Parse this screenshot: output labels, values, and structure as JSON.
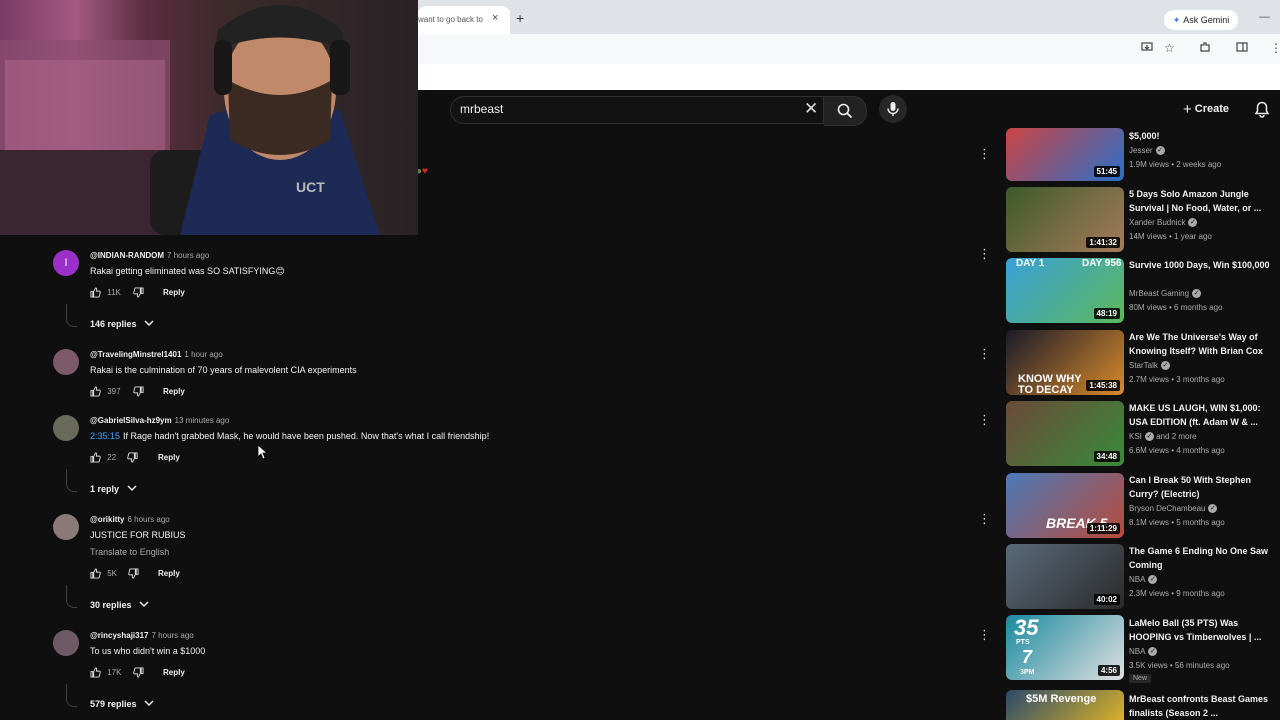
{
  "browser": {
    "tab_title": "want to go back to",
    "tab_close_icon": "×",
    "new_tab_icon": "+",
    "gemini_label": "Ask Gemini",
    "minimize_icon": "—"
  },
  "header": {
    "search_value": "mrbeast",
    "clear_icon": "✕",
    "create_label": "Create",
    "create_icon": "+"
  },
  "comments": [
    {
      "author": "@INDIAN-RANDOM",
      "time": "7 hours ago",
      "text": "Rakai getting eliminated was SO SATISFYING😊",
      "likes": "11K",
      "reply": "Reply",
      "replies": "146 replies",
      "avatar_letter": "I",
      "avatar_color": "#9b30c8"
    },
    {
      "author": "@TravelingMinstrel1401",
      "time": "1 hour ago",
      "text": "Rakai is the culmination of 70 years of malevolent CIA experiments",
      "likes": "397",
      "reply": "Reply",
      "avatar_color": "#7d5a6a"
    },
    {
      "author": "@GabrielSilva-hz9ym",
      "time": "13 minutes ago",
      "timestamp": "2:35:15",
      "text": "If Rage hadn't grabbed Mask, he would have been pushed. Now that's what I call friendship!",
      "likes": "22",
      "reply": "Reply",
      "replies": "1 reply",
      "avatar_color": "#6a6a5a"
    },
    {
      "author": "@orikitty",
      "time": "6 hours ago",
      "text": "JUSTICE FOR RUBIUS",
      "translate": "Translate to English",
      "likes": "5K",
      "reply": "Reply",
      "replies": "30 replies",
      "avatar_color": "#8a7a78"
    },
    {
      "author": "@rincyshaji317",
      "time": "7 hours ago",
      "text": "To us who didn't win a $1000",
      "likes": "17K",
      "reply": "Reply",
      "replies": "579 replies",
      "avatar_color": "#6e5a66"
    }
  ],
  "videos": [
    {
      "title": "$5,000!",
      "channel": "Jesser",
      "meta": "1.9M views • 2 weeks ago",
      "duration": "51:45",
      "colors": [
        "#c44",
        "#2a6fc8"
      ]
    },
    {
      "title": "5 Days Solo Amazon Jungle Survival | No Food, Water, or ...",
      "channel": "Xander Budnick",
      "meta": "14M views • 1 year ago",
      "duration": "1:41:32",
      "colors": [
        "#3d5a2a",
        "#a67b5b"
      ]
    },
    {
      "title": "Survive 1000 Days, Win $100,000",
      "channel": "MrBeast Gaming",
      "meta": "80M views • 6 months ago",
      "duration": "48:19",
      "colors": [
        "#3aa0d8",
        "#5cb85c"
      ],
      "overlay_left": "DAY 1",
      "overlay_right": "DAY 956"
    },
    {
      "title": "Are We The Universe's Way of Knowing Itself? With Brian Cox",
      "channel": "StarTalk",
      "meta": "2.7M views • 3 months ago",
      "duration": "1:45:38",
      "colors": [
        "#1a1a2a",
        "#d88a2a"
      ],
      "overlay_text": "KNOW WHY TO DECAY"
    },
    {
      "title": "MAKE US LAUGH, WIN $1,000: USA EDITION (ft. Adam W & ...",
      "channel": "KSI",
      "channel_extra": "and 2 more",
      "meta": "6.6M views • 4 months ago",
      "duration": "34:48",
      "colors": [
        "#6b4a3a",
        "#3a8a3a"
      ]
    },
    {
      "title": "Can I Break 50 With Stephen Curry? (Electric)",
      "channel": "Bryson DeChambeau",
      "meta": "8.1M views • 5 months ago",
      "duration": "1:11:29",
      "colors": [
        "#4a7ab8",
        "#b84a3a"
      ],
      "overlay_text": "BREAK 5"
    },
    {
      "title": "The Game 6 Ending No One Saw Coming",
      "channel": "NBA",
      "meta": "2.3M views • 9 months ago",
      "duration": "40:02",
      "colors": [
        "#5a6a7a",
        "#2a2a2a"
      ]
    },
    {
      "title": "LaMelo Ball (35 PTS) Was HOOPING vs Timberwolves | ...",
      "channel": "NBA",
      "meta": "3.5K views • 56 minutes ago",
      "duration": "4:56",
      "badge": "New",
      "colors": [
        "#1a8aa0",
        "#e0e0e0"
      ],
      "overlay_big": "35",
      "overlay_small": "PTS",
      "overlay_big2": "7",
      "overlay_small2": "3PM"
    },
    {
      "title": "MrBeast confronts Beast Games finalists (Season 2 ...",
      "channel": "",
      "meta": "",
      "duration": "",
      "colors": [
        "#2a4a6a",
        "#d8b02a"
      ],
      "overlay_text": "$5M Revenge"
    }
  ]
}
